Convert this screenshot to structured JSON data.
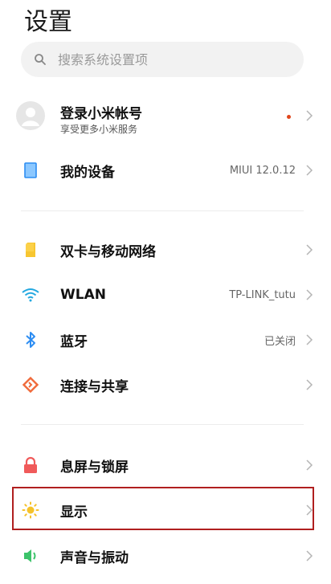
{
  "header": {
    "title": "设置"
  },
  "search": {
    "placeholder": "搜索系统设置项"
  },
  "account": {
    "title": "登录小米帐号",
    "subtitle": "享受更多小米服务",
    "has_notification": true,
    "notification_color": "#e0461c"
  },
  "items": [
    {
      "id": "my-device",
      "label": "我的设备",
      "value": "MIUI 12.0.12",
      "icon": "device-icon",
      "icon_color": "#2d8df2"
    },
    {
      "id": "dual-sim",
      "label": "双卡与移动网络",
      "value": "",
      "icon": "sim-card-icon",
      "icon_color": "#f7c630"
    },
    {
      "id": "wlan",
      "label": "WLAN",
      "value": "TP-LINK_tutu",
      "icon": "wifi-icon",
      "icon_color": "#23a8e0"
    },
    {
      "id": "bluetooth",
      "label": "蓝牙",
      "value": "已关闭",
      "icon": "bluetooth-icon",
      "icon_color": "#2d8df2"
    },
    {
      "id": "connect-share",
      "label": "连接与共享",
      "value": "",
      "icon": "share-icon",
      "icon_color": "#f06a3a"
    },
    {
      "id": "lock-screen",
      "label": "息屏与锁屏",
      "value": "",
      "icon": "lock-icon",
      "icon_color": "#f05a5a"
    },
    {
      "id": "display",
      "label": "显示",
      "value": "",
      "icon": "sun-icon",
      "icon_color": "#f5c22a",
      "highlighted": true
    },
    {
      "id": "sound",
      "label": "声音与振动",
      "value": "",
      "icon": "speaker-icon",
      "icon_color": "#3cc36a"
    }
  ]
}
